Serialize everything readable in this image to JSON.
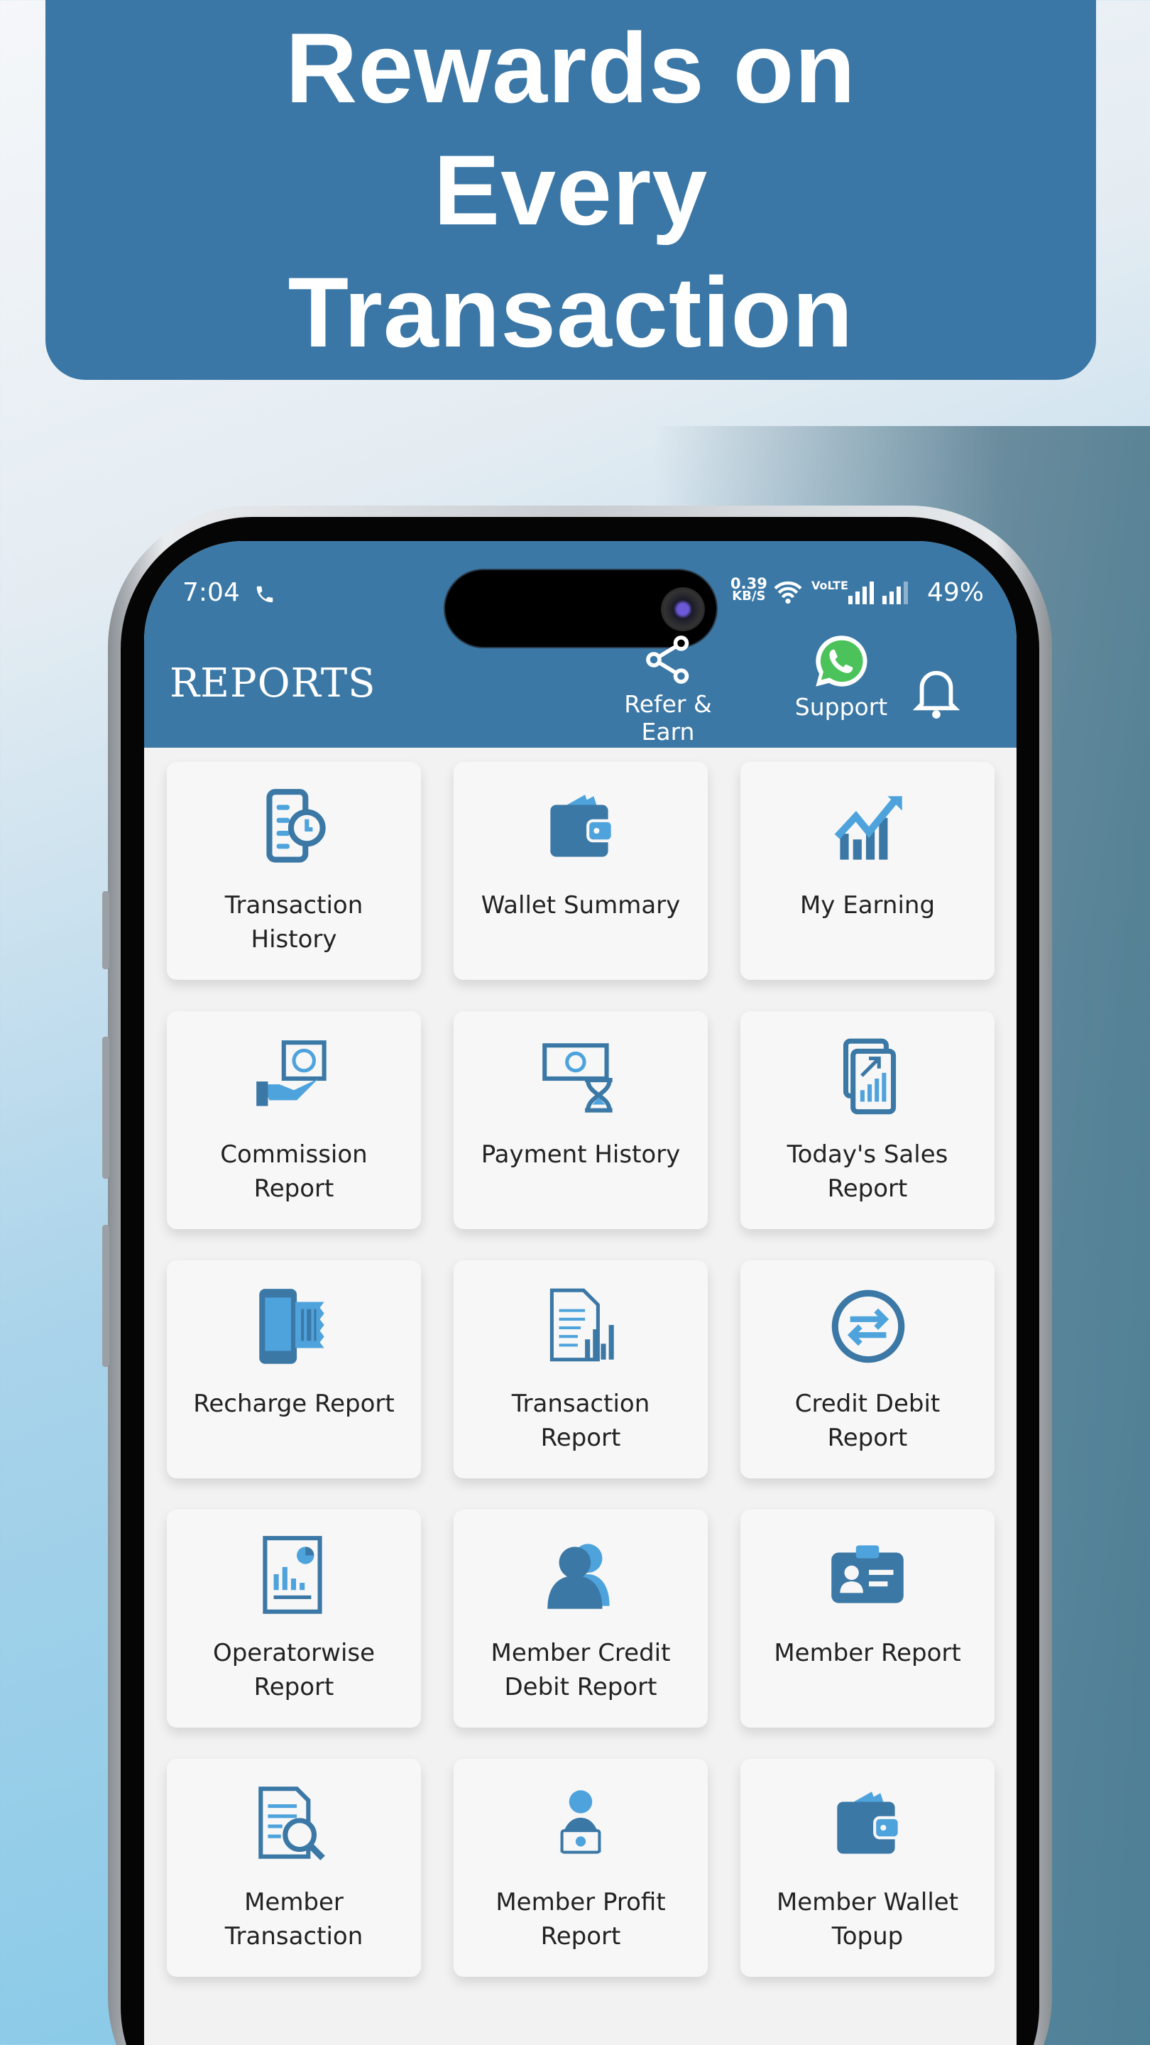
{
  "banner": {
    "title": "Rewards on Every Transaction"
  },
  "status_bar": {
    "time": "7:04",
    "net_speed": "0.39",
    "net_unit": "KB/S",
    "volte": "VoLTE",
    "battery": "49%"
  },
  "header": {
    "title": "REPORTS",
    "actions": [
      {
        "label": "Refer & Earn",
        "icon": "share-icon"
      },
      {
        "label": "Support",
        "icon": "whatsapp-icon"
      },
      {
        "label": "",
        "icon": "bell-icon"
      }
    ]
  },
  "colors": {
    "primary": "#3b78a6",
    "accent": "#4ea3dc",
    "whatsapp": "#4cc25a"
  },
  "reports": [
    {
      "label": "Transaction\nHistory",
      "icon": "history"
    },
    {
      "label": "Wallet Summary",
      "icon": "wallet"
    },
    {
      "label": "My Earning",
      "icon": "growth"
    },
    {
      "label": "Commission\nReport",
      "icon": "commission"
    },
    {
      "label": "Payment History",
      "icon": "payment"
    },
    {
      "label": "Today's Sales\nReport",
      "icon": "sales"
    },
    {
      "label": "Recharge Report",
      "icon": "recharge"
    },
    {
      "label": "Transaction\nReport",
      "icon": "txn-report"
    },
    {
      "label": "Credit Debit\nReport",
      "icon": "exchange"
    },
    {
      "label": "Operatorwise\nReport",
      "icon": "operator"
    },
    {
      "label": "Member Credit\nDebit Report",
      "icon": "members"
    },
    {
      "label": "Member Report",
      "icon": "id-card"
    },
    {
      "label": "Member\nTransaction",
      "icon": "doc-search"
    },
    {
      "label": "Member Profit\nReport",
      "icon": "profit"
    },
    {
      "label": "Member Wallet\nTopup",
      "icon": "wallet"
    }
  ]
}
